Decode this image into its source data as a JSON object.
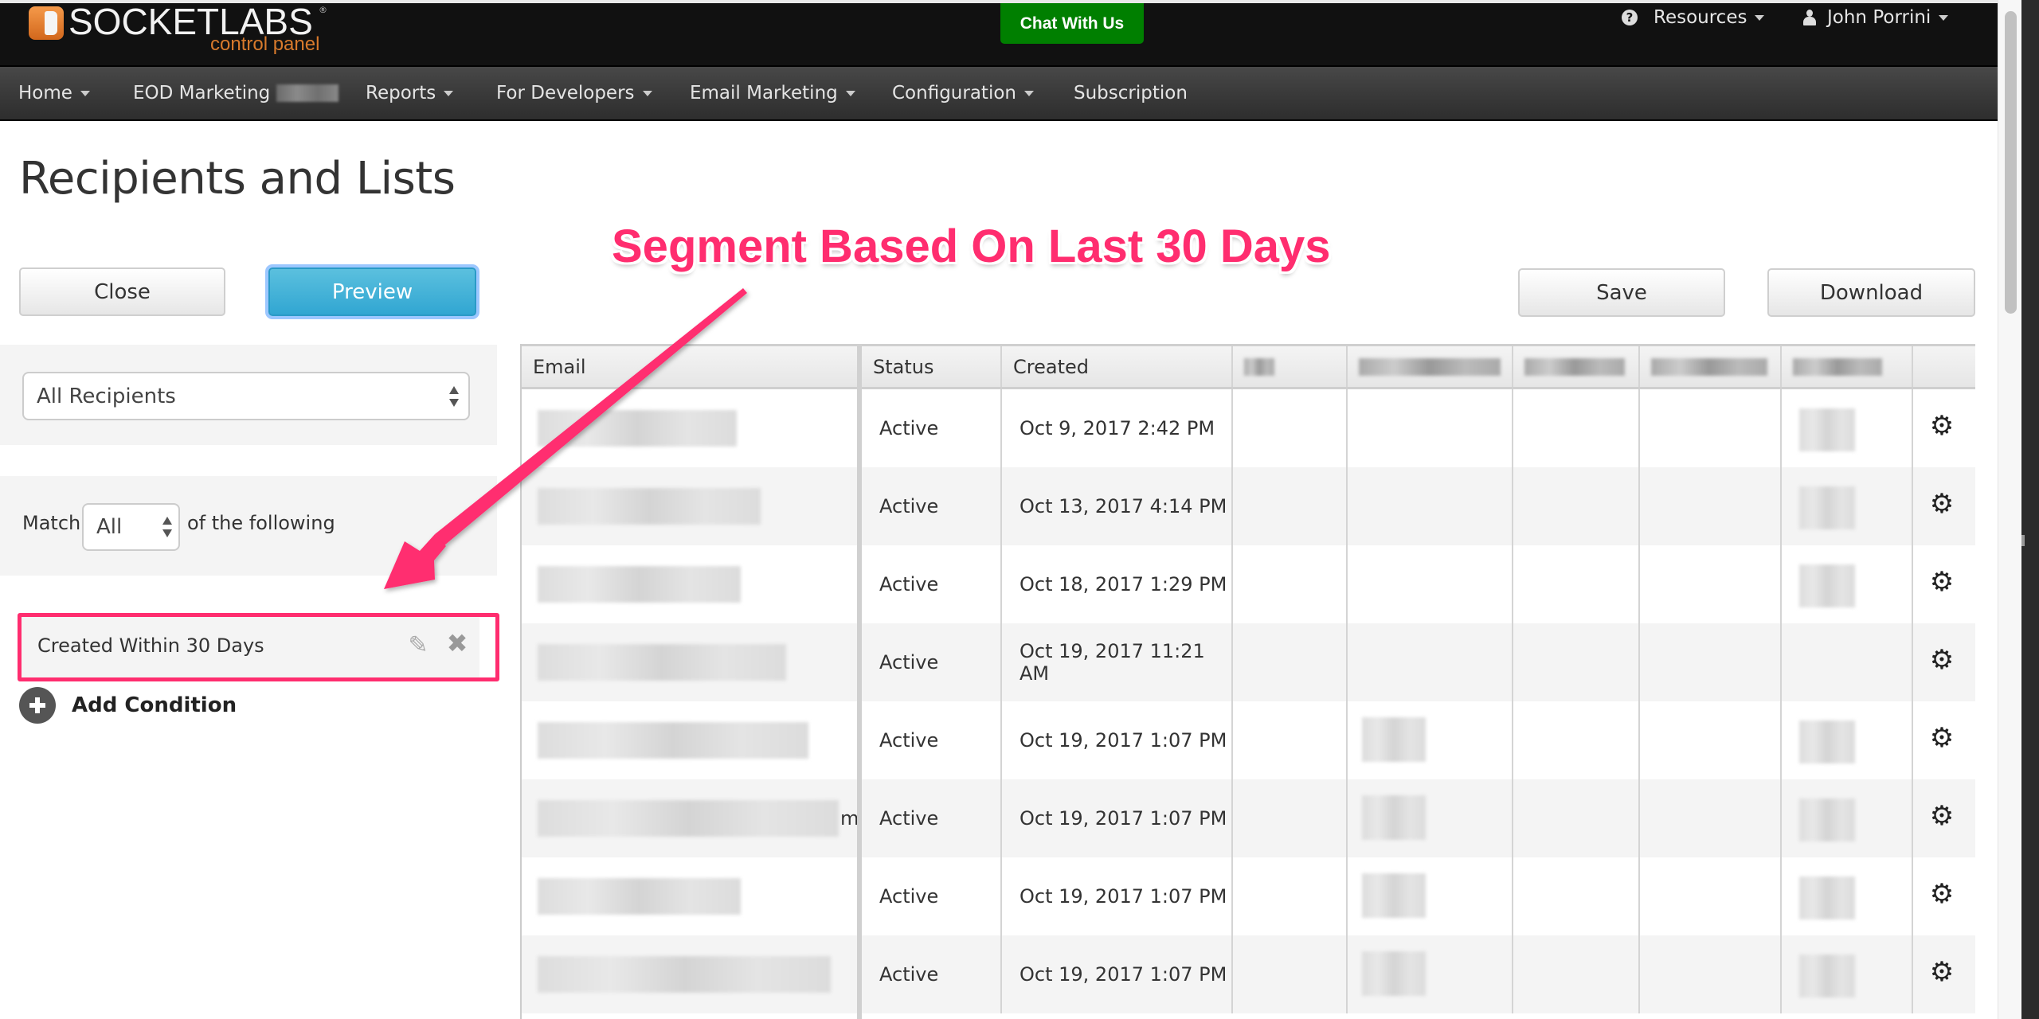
{
  "header": {
    "logo_word": "SOCKETLABS",
    "logo_registered": "®",
    "logo_sub": "control panel",
    "chat_button": "Chat With Us",
    "resources_label": "Resources",
    "user_label": "John Porrini",
    "chat_color": "#007f00"
  },
  "nav": {
    "items": [
      {
        "label": "Home",
        "dropdown": true
      },
      {
        "label": "EOD Marketing",
        "dropdown": false,
        "redacted_suffix": true
      },
      {
        "label": "Reports",
        "dropdown": true
      },
      {
        "label": "For Developers",
        "dropdown": true
      },
      {
        "label": "Email Marketing",
        "dropdown": true
      },
      {
        "label": "Configuration",
        "dropdown": true
      },
      {
        "label": "Subscription",
        "dropdown": false
      }
    ]
  },
  "page": {
    "title": "Recipients and Lists",
    "close_button": "Close",
    "preview_button": "Preview",
    "save_button": "Save",
    "download_button": "Download"
  },
  "filters": {
    "list_select_value": "All Recipients",
    "match_prefix": "Match",
    "match_select_value": "All",
    "match_suffix": "of the following",
    "conditions": [
      {
        "label": "Created Within 30 Days"
      }
    ],
    "add_condition": "Add Condition"
  },
  "annotation": {
    "text": "Segment Based On Last 30 Days",
    "color": "#ff2d6f"
  },
  "table": {
    "columns": [
      "Email",
      "Status",
      "Created",
      "",
      "",
      "",
      "",
      "",
      ""
    ],
    "rows": [
      {
        "email": "",
        "status": "Active",
        "created": "Oct 9, 2017 2:42 PM"
      },
      {
        "email": "",
        "status": "Active",
        "created": "Oct 13, 2017 4:14 PM"
      },
      {
        "email": "",
        "status": "Active",
        "created": "Oct 18, 2017 1:29 PM"
      },
      {
        "email": "",
        "status": "Active",
        "created": "Oct 19, 2017 11:21 AM"
      },
      {
        "email": "",
        "status": "Active",
        "created": "Oct 19, 2017 1:07 PM"
      },
      {
        "email": "",
        "email_tail": "m",
        "status": "Active",
        "created": "Oct 19, 2017 1:07 PM"
      },
      {
        "email": "",
        "status": "Active",
        "created": "Oct 19, 2017 1:07 PM"
      },
      {
        "email": "",
        "status": "Active",
        "created": "Oct 19, 2017 1:07 PM"
      }
    ],
    "row_action_icon": "gear-icon"
  },
  "icons": {
    "help": "?",
    "pencil": "✎",
    "close": "✖",
    "gear": "⚙"
  }
}
